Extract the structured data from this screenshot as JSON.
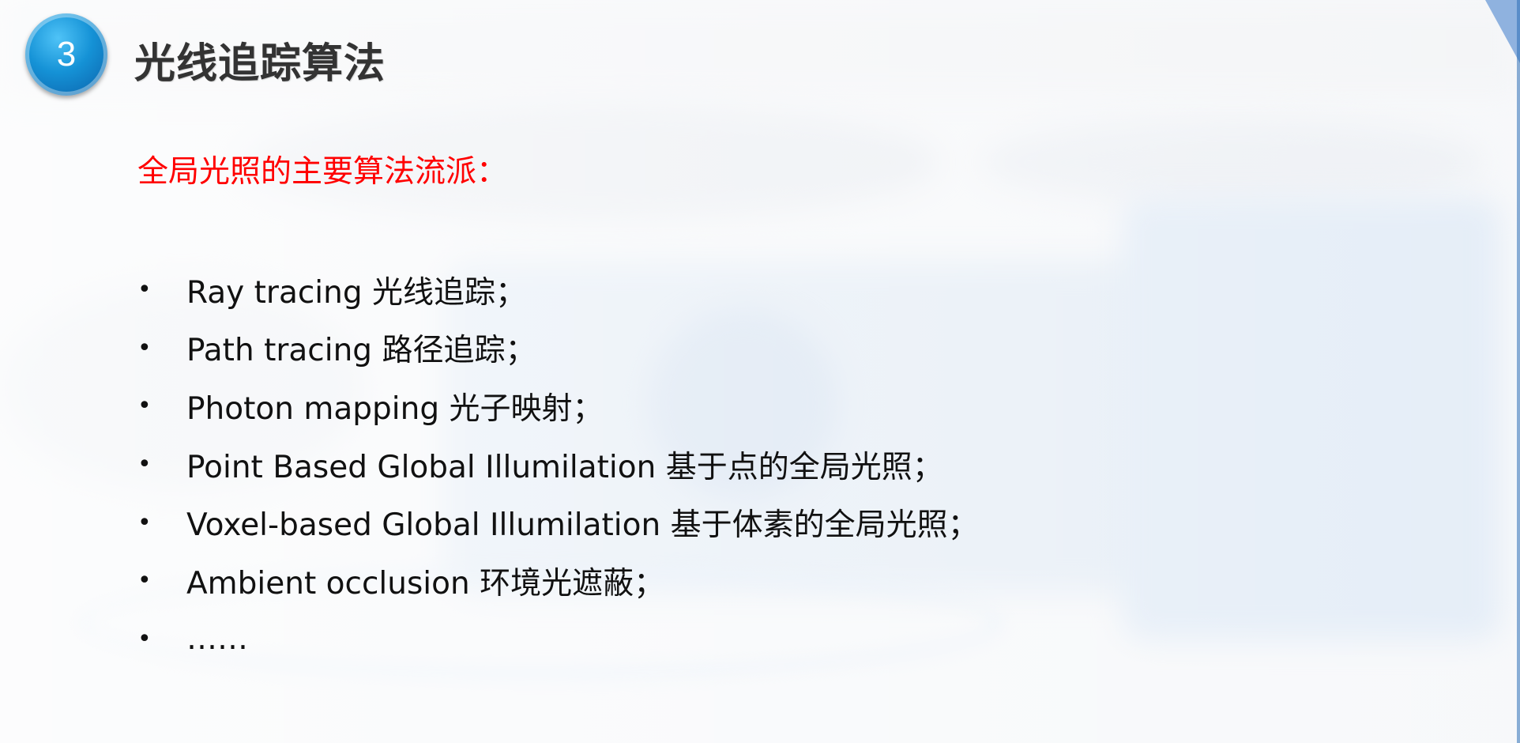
{
  "slide": {
    "section_number": "3",
    "title": "光线追踪算法",
    "subtitle": "全局光照的主要算法流派：",
    "bullet_symbol": "•",
    "bullets": [
      "Ray tracing 光线追踪；",
      "Path tracing 路径追踪；",
      "Photon mapping 光子映射；",
      "Point Based Global Illumilation 基于点的全局光照；",
      "Voxel-based Global Illumilation 基于体素的全局光照；",
      "Ambient occlusion 环境光遮蔽；",
      "……"
    ]
  },
  "colors": {
    "badge": "#1592d6",
    "title": "#333333",
    "subtitle": "#ff0000",
    "body_text": "#111111",
    "corner_accent": "#8fb2df"
  }
}
